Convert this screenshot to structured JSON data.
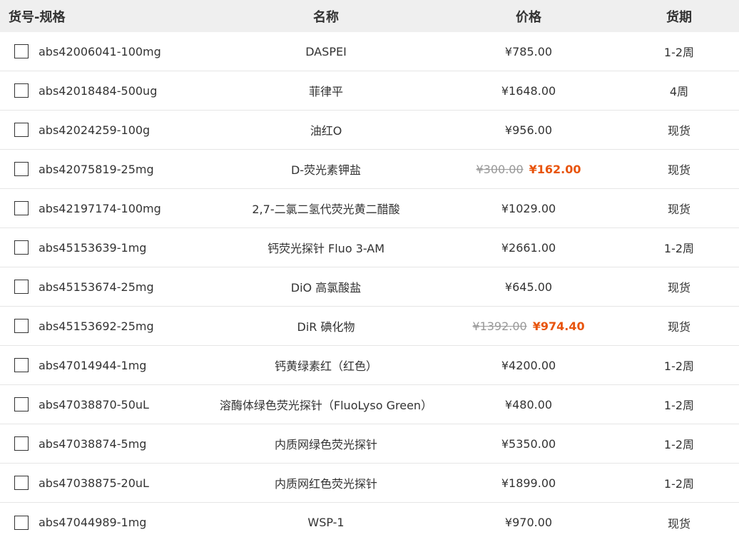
{
  "header": {
    "sku": "货号-规格",
    "name": "名称",
    "price": "价格",
    "lead": "货期"
  },
  "rows": [
    {
      "sku": "abs42006041-100mg",
      "name": "DASPEI",
      "price": "¥785.00",
      "old_price": "",
      "lead": "1-2周"
    },
    {
      "sku": "abs42018484-500ug",
      "name": "菲律平",
      "price": "¥1648.00",
      "old_price": "",
      "lead": "4周"
    },
    {
      "sku": "abs42024259-100g",
      "name": "油红O",
      "price": "¥956.00",
      "old_price": "",
      "lead": "现货"
    },
    {
      "sku": "abs42075819-25mg",
      "name": "D-荧光素钾盐",
      "price": "¥162.00",
      "old_price": "¥300.00",
      "lead": "现货"
    },
    {
      "sku": "abs42197174-100mg",
      "name": "2,7-二氯二氢代荧光黄二醋酸",
      "price": "¥1029.00",
      "old_price": "",
      "lead": "现货"
    },
    {
      "sku": "abs45153639-1mg",
      "name": "钙荧光探针 Fluo 3-AM",
      "price": "¥2661.00",
      "old_price": "",
      "lead": "1-2周"
    },
    {
      "sku": "abs45153674-25mg",
      "name": "DiO 高氯酸盐",
      "price": "¥645.00",
      "old_price": "",
      "lead": "现货"
    },
    {
      "sku": "abs45153692-25mg",
      "name": "DiR 碘化物",
      "price": "¥974.40",
      "old_price": "¥1392.00",
      "lead": "现货"
    },
    {
      "sku": "abs47014944-1mg",
      "name": "钙黄绿素红（红色）",
      "price": "¥4200.00",
      "old_price": "",
      "lead": "1-2周"
    },
    {
      "sku": "abs47038870-50uL",
      "name": "溶酶体绿色荧光探针（FluoLyso Green）",
      "price": "¥480.00",
      "old_price": "",
      "lead": "1-2周"
    },
    {
      "sku": "abs47038874-5mg",
      "name": "内质网绿色荧光探针",
      "price": "¥5350.00",
      "old_price": "",
      "lead": "1-2周"
    },
    {
      "sku": "abs47038875-20uL",
      "name": "内质网红色荧光探针",
      "price": "¥1899.00",
      "old_price": "",
      "lead": "1-2周"
    },
    {
      "sku": "abs47044989-1mg",
      "name": "WSP-1",
      "price": "¥970.00",
      "old_price": "",
      "lead": "现货"
    }
  ],
  "colors": {
    "header_bg": "#efefef",
    "sale_price": "#e8540c",
    "old_price": "#999999",
    "row_border": "#e6e6e6"
  }
}
